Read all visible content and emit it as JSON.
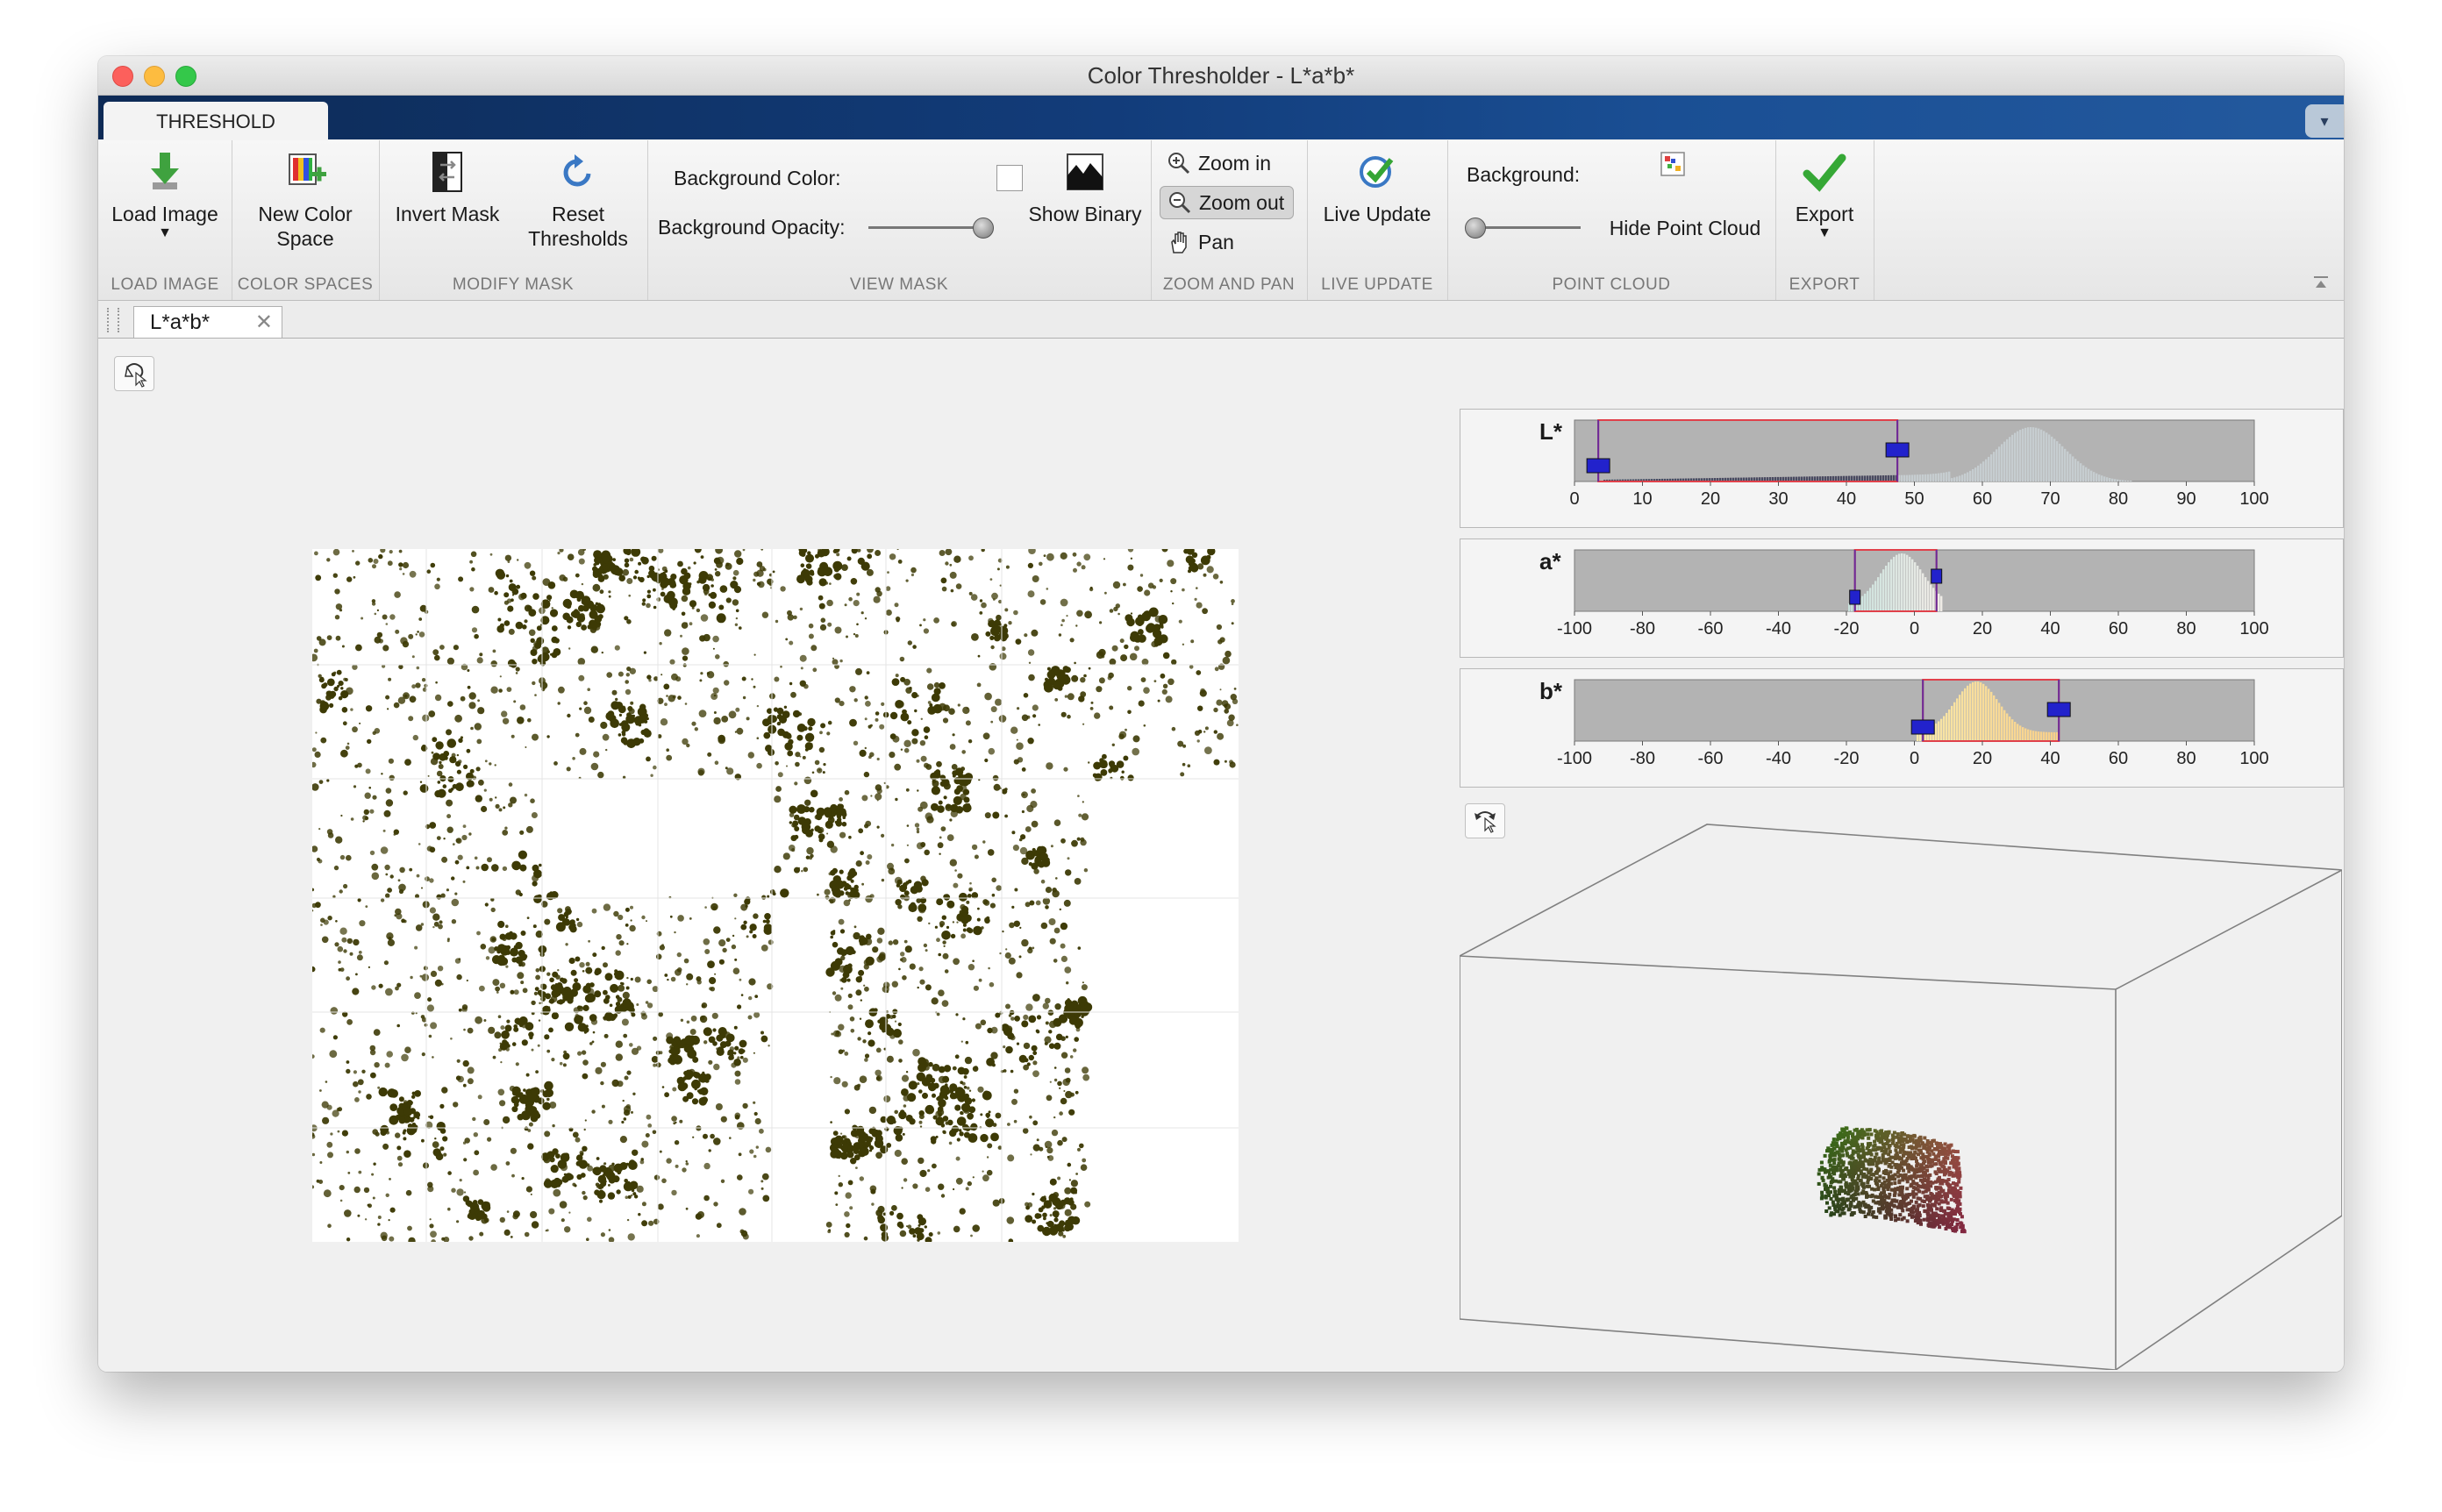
{
  "window": {
    "title": "Color Thresholder - L*a*b*"
  },
  "ribbon": {
    "tab": "THRESHOLD",
    "load_image": {
      "label": "Load Image",
      "group": "LOAD IMAGE"
    },
    "new_color_space": {
      "label": "New Color Space",
      "group": "COLOR SPACES"
    },
    "invert_mask": {
      "label": "Invert Mask"
    },
    "reset_thresholds": {
      "label_line1": "Reset",
      "label_line2": "Thresholds"
    },
    "modify_mask_group": "MODIFY MASK",
    "background_color_label": "Background Color:",
    "background_opacity_label": "Background Opacity:",
    "background_opacity_value": 1.0,
    "show_binary": {
      "label": "Show Binary"
    },
    "view_mask_group": "VIEW MASK",
    "zoom_in": {
      "label": "Zoom in"
    },
    "zoom_out": {
      "label": "Zoom out"
    },
    "pan": {
      "label": "Pan"
    },
    "zoom_pan_group": "ZOOM AND PAN",
    "live_update": {
      "label": "Live Update",
      "group": "LIVE UPDATE"
    },
    "background_label": "Background:",
    "hide_point_cloud": {
      "label": "Hide Point Cloud"
    },
    "point_cloud_group": "POINT CLOUD",
    "export": {
      "label": "Export",
      "group": "EXPORT"
    }
  },
  "document_tab": {
    "label": "L*a*b*"
  },
  "colors": {
    "selection_box": "#e0404a",
    "handle": "#2222cc",
    "hist_bg": "#b3b3b3",
    "mask_blob": "#3d3a05"
  },
  "histograms": [
    {
      "label": "L*",
      "ticks": [
        "0",
        "10",
        "20",
        "30",
        "40",
        "50",
        "60",
        "70",
        "80",
        "90",
        "100"
      ],
      "range": [
        0,
        100
      ],
      "selection": [
        3.5,
        47.5
      ]
    },
    {
      "label": "a*",
      "ticks": [
        "-100",
        "-80",
        "-60",
        "-40",
        "-20",
        "0",
        "20",
        "40",
        "60",
        "80",
        "100"
      ],
      "range": [
        -100,
        100
      ],
      "selection": [
        -17.5,
        6.5
      ]
    },
    {
      "label": "b*",
      "ticks": [
        "-100",
        "-80",
        "-60",
        "-40",
        "-20",
        "0",
        "20",
        "40",
        "60",
        "80",
        "100"
      ],
      "range": [
        -100,
        100
      ],
      "selection": [
        2.5,
        42.5
      ]
    }
  ]
}
